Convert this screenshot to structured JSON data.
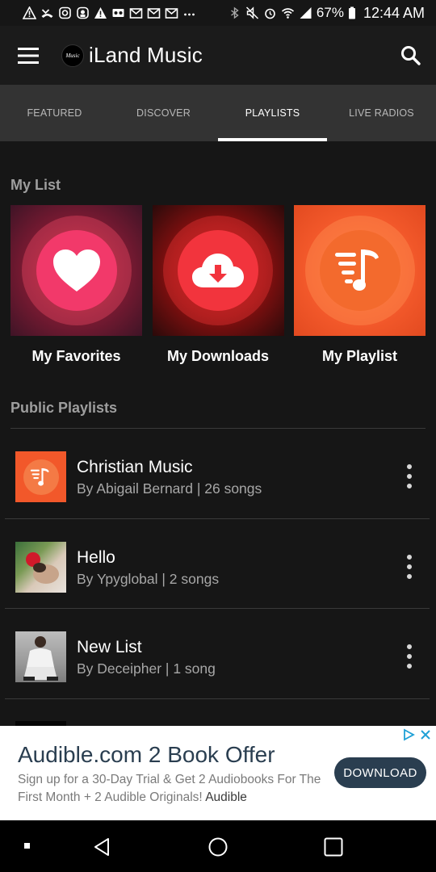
{
  "status_bar": {
    "battery": "67%",
    "time": "12:44 AM",
    "left_icons": [
      "warning-icon",
      "missed-call-icon",
      "instagram-icon",
      "eye-icon",
      "warning-icon",
      "voicemail-icon",
      "gmail-icon",
      "gmail-icon",
      "gmail-icon",
      "more-dots-icon"
    ],
    "right_icons": [
      "bluetooth-icon",
      "mute-icon",
      "alarm-icon",
      "wifi-icon",
      "signal-icon",
      "battery-icon"
    ]
  },
  "app_bar": {
    "logo_text": "Music",
    "title": "iLand Music"
  },
  "tabs": [
    {
      "label": "FEATURED",
      "active": false
    },
    {
      "label": "DISCOVER",
      "active": false
    },
    {
      "label": "PLAYLISTS",
      "active": true
    },
    {
      "label": "LIVE RADIOS",
      "active": false
    }
  ],
  "my_list": {
    "title": "My List",
    "items": [
      {
        "label": "My Favorites",
        "icon": "heart-icon"
      },
      {
        "label": "My Downloads",
        "icon": "cloud-download-icon"
      },
      {
        "label": "My Playlist",
        "icon": "playlist-music-icon"
      }
    ]
  },
  "public_playlists": {
    "title": "Public Playlists",
    "items": [
      {
        "name": "Christian Music",
        "meta": "By Abigail Bernard | 26 songs"
      },
      {
        "name": "Hello",
        "meta": "By Ypyglobal | 2 songs"
      },
      {
        "name": "New List",
        "meta": "By Deceipher | 1 song"
      }
    ]
  },
  "ad": {
    "title": "Audible.com 2 Book Offer",
    "body": "Sign up for a 30-Day Trial & Get 2 Audiobooks For The First Month + 2 Audible Originals!",
    "advertiser": "Audible",
    "cta": "DOWNLOAD"
  },
  "colors": {
    "background": "#161616",
    "tab_bar": "#333333",
    "accent_orange": "#f2582a",
    "ad_button": "#2a3e50"
  }
}
